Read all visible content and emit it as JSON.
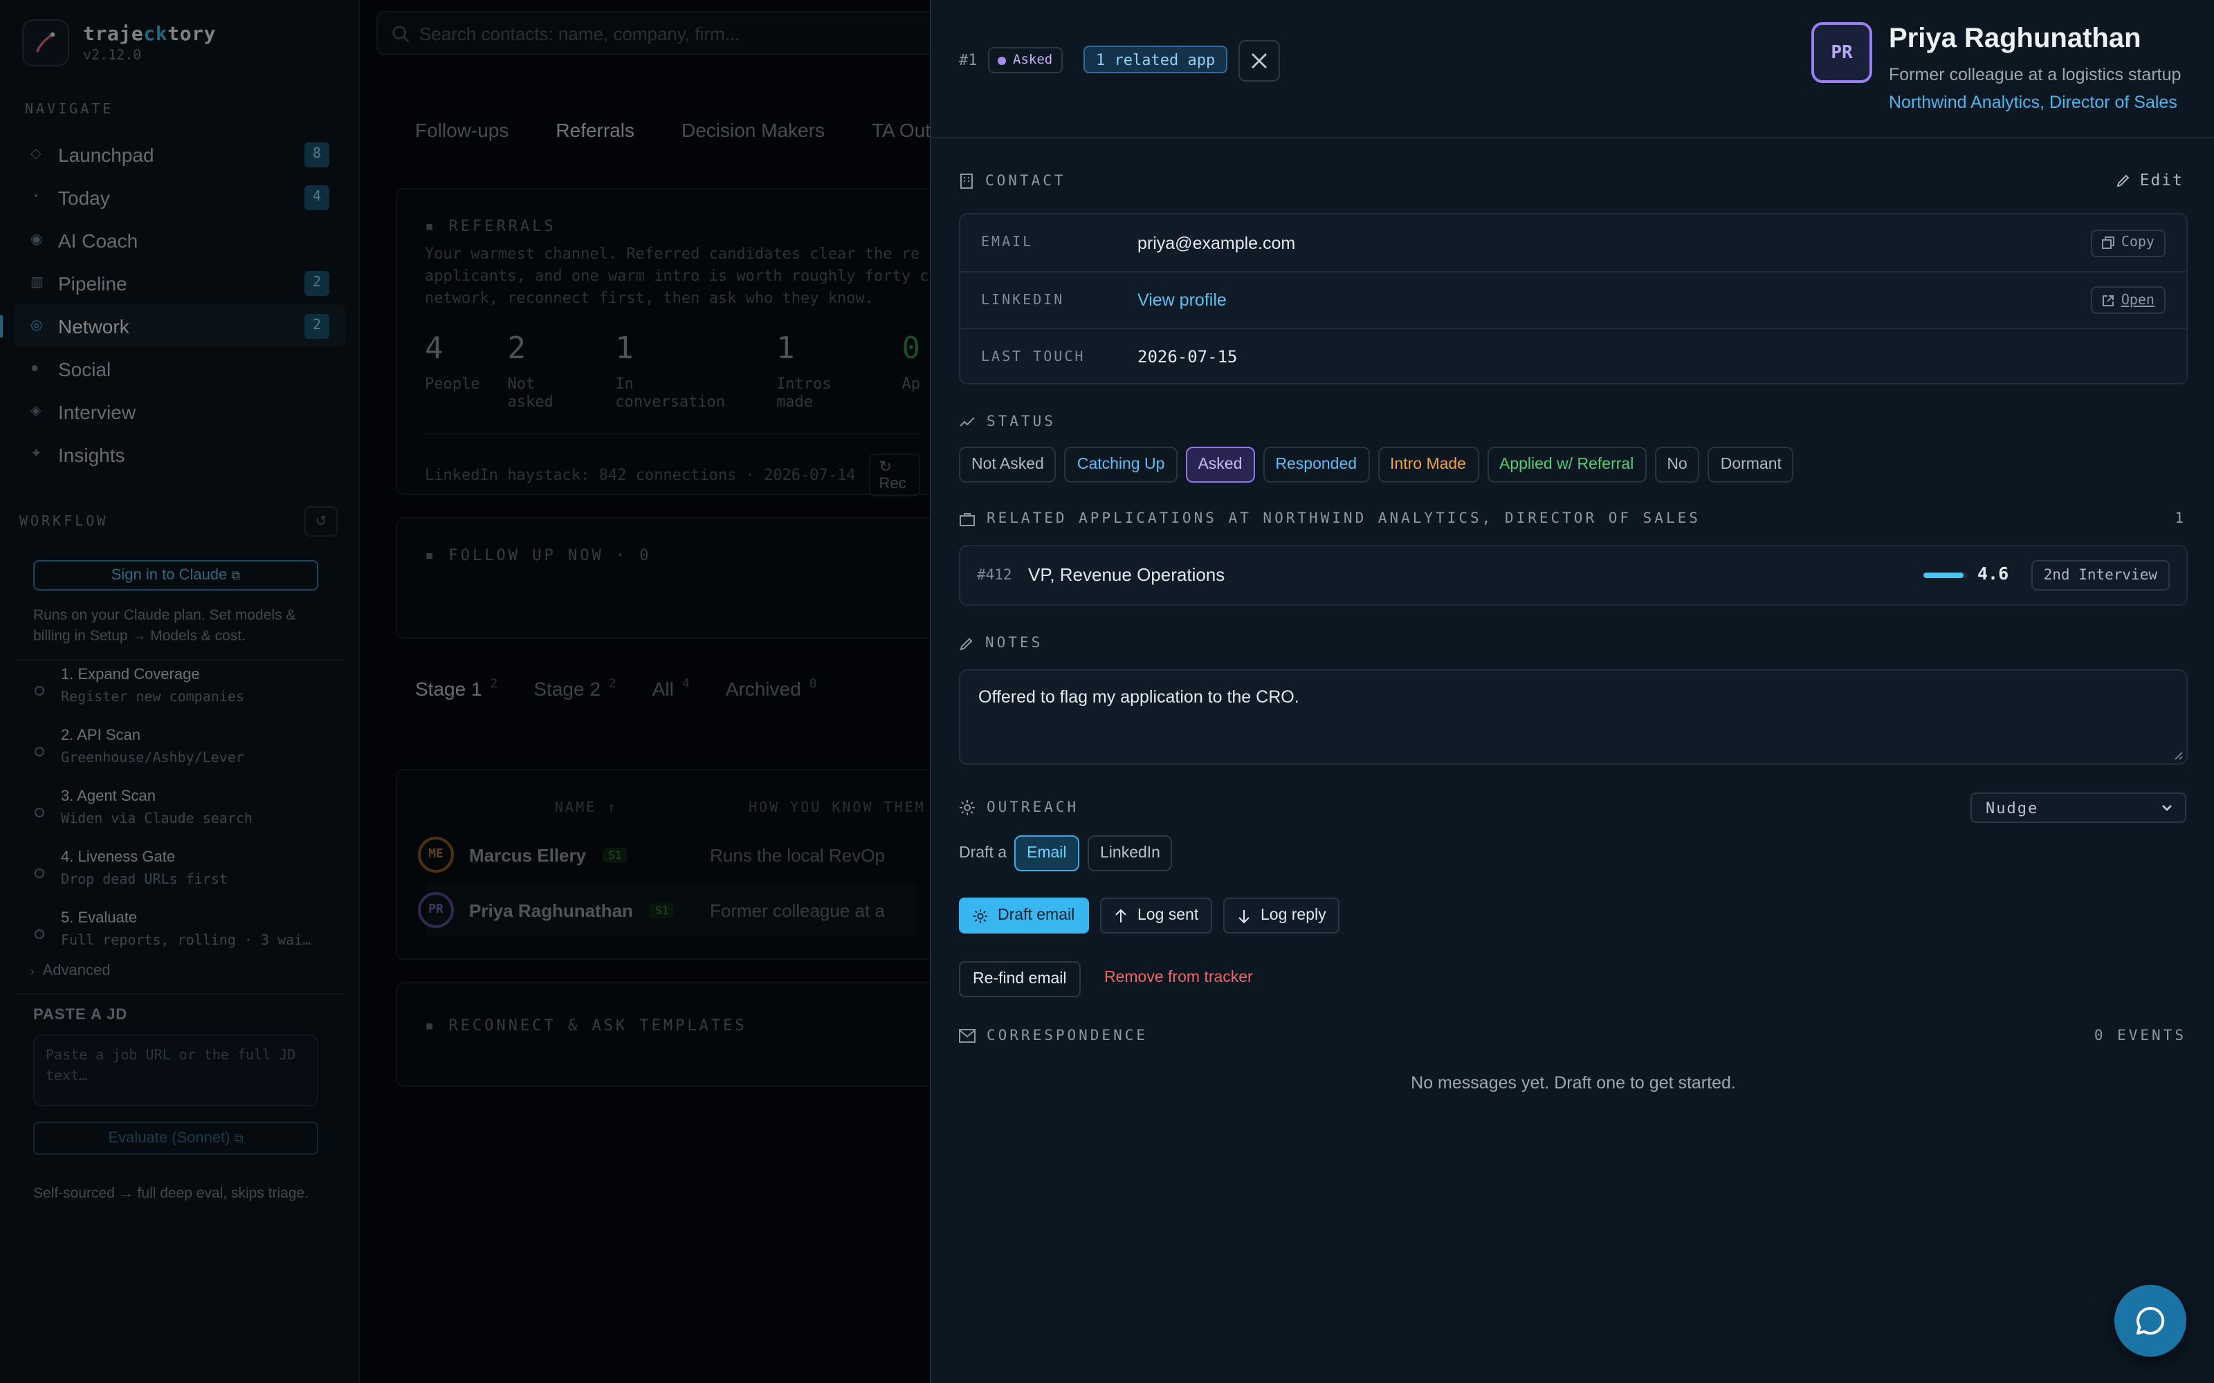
{
  "app": {
    "name_part1": "traje",
    "name_accent": "ck",
    "name_part2": "tory",
    "version": "v2.12.0"
  },
  "sidebar": {
    "navigate_title": "NAVIGATE",
    "nav": [
      {
        "label": "Launchpad",
        "count": "8",
        "icon": "diamond-icon"
      },
      {
        "label": "Today",
        "count": "4",
        "icon": "clock-icon"
      },
      {
        "label": "AI Coach",
        "count": "",
        "icon": "target-icon"
      },
      {
        "label": "Pipeline",
        "count": "2",
        "icon": "columns-icon"
      },
      {
        "label": "Network",
        "count": "2",
        "icon": "network-icon",
        "active": true
      },
      {
        "label": "Social",
        "count": "",
        "icon": "circle-icon"
      },
      {
        "label": "Interview",
        "count": "",
        "icon": "diamond-dot-icon"
      },
      {
        "label": "Insights",
        "count": "",
        "icon": "sparkle-icon"
      }
    ],
    "workflow_title": "WORKFLOW",
    "signin_label": "Sign in to Claude",
    "plan_note": "Runs on your Claude plan. Set models & billing in Setup → Models & cost.",
    "steps": [
      {
        "title": "1. Expand Coverage",
        "sub": "Register new companies"
      },
      {
        "title": "2. API Scan",
        "sub": "Greenhouse/Ashby/Lever"
      },
      {
        "title": "3. Agent Scan",
        "sub": "Widen via Claude search"
      },
      {
        "title": "4. Liveness Gate",
        "sub": "Drop dead URLs first"
      },
      {
        "title": "5. Evaluate",
        "sub": "Full reports, rolling · 3 wai…"
      }
    ],
    "advanced_label": "Advanced",
    "jd_label": "PASTE A JD",
    "jd_placeholder": "Paste a job URL or the full JD text…",
    "evaluate_label": "Evaluate (Sonnet)",
    "self_sourced_note": "Self-sourced → full deep eval, skips triage."
  },
  "main": {
    "search_placeholder": "Search contacts: name, company, firm...",
    "tabs": [
      "Follow-ups",
      "Referrals",
      "Decision Makers",
      "TA Out"
    ],
    "referrals_title": "REFERRALS",
    "referrals_desc": [
      "Your warmest channel. Referred candidates clear the re",
      "applicants, and one warm intro is worth roughly forty c",
      "network, reconnect first, then ask who they know."
    ],
    "stats": [
      {
        "n": "4",
        "l": "People"
      },
      {
        "n": "2",
        "l": "Not asked"
      },
      {
        "n": "1",
        "l": "In conversation"
      },
      {
        "n": "1",
        "l": "Intros made"
      },
      {
        "n": "0",
        "l": "Ap"
      }
    ],
    "haystack": "LinkedIn haystack: 842 connections · 2026-07-14",
    "haystack_btn": "↻ Rec",
    "followup_title": "FOLLOW UP NOW · 0",
    "stage_tabs": [
      {
        "label": "Stage 1",
        "count": "2"
      },
      {
        "label": "Stage 2",
        "count": "2"
      },
      {
        "label": "All",
        "count": "4"
      },
      {
        "label": "Archived",
        "count": "0"
      }
    ],
    "col_name": "NAME ↑",
    "col_how": "HOW YOU KNOW THEM",
    "rows": [
      {
        "initials": "ME",
        "name": "Marcus Ellery",
        "stage": "S1",
        "how": "Runs the local RevOp"
      },
      {
        "initials": "PR",
        "name": "Priya Raghunathan",
        "stage": "S1",
        "how": "Former colleague at a"
      }
    ],
    "templates_title": "RECONNECT & ASK TEMPLATES"
  },
  "drawer": {
    "id": "#1",
    "status_pill": "Asked",
    "related_pill": "1 related app",
    "initials": "PR",
    "name": "Priya Raghunathan",
    "subtitle": "Former colleague at a logistics startup",
    "company": "Northwind Analytics, Director of Sales",
    "contact_title": "CONTACT",
    "edit_label": "Edit",
    "email_key": "EMAIL",
    "email": "priya@example.com",
    "copy_label": "Copy",
    "linkedin_key": "LINKEDIN",
    "linkedin": "View profile",
    "open_label": "Open",
    "last_touch_key": "LAST TOUCH",
    "last_touch": "2026-07-15",
    "status_title": "STATUS",
    "statuses": [
      {
        "label": "Not Asked",
        "color": "#aeb9c3"
      },
      {
        "label": "Catching Up",
        "color": "#5cc0f2"
      },
      {
        "label": "Asked",
        "color": "#c9bdf8",
        "selected": true
      },
      {
        "label": "Responded",
        "color": "#5cc0f2"
      },
      {
        "label": "Intro Made",
        "color": "#f0a13c"
      },
      {
        "label": "Applied w/ Referral",
        "color": "#4fcf78"
      },
      {
        "label": "No",
        "color": "#aeb9c3"
      },
      {
        "label": "Dormant",
        "color": "#aeb9c3"
      }
    ],
    "related_title": "RELATED APPLICATIONS AT NORTHWIND ANALYTICS, DIRECTOR OF SALES",
    "related_count": "1",
    "app_id": "#412",
    "app_title": "VP, Revenue Operations",
    "app_score": "4.6",
    "app_score_fraction": 0.92,
    "app_stage": "2nd Interview",
    "notes_title": "NOTES",
    "notes": "Offered to flag my application to the CRO.",
    "outreach_title": "OUTREACH",
    "outreach_mode": "Nudge",
    "draft_a": "Draft a",
    "channel_email": "Email",
    "channel_linkedin": "LinkedIn",
    "draft_email": "Draft email",
    "log_sent": "Log sent",
    "log_reply": "Log reply",
    "refind_email": "Re-find email",
    "remove": "Remove from tracker",
    "correspondence_title": "CORRESPONDENCE",
    "events": "0 EVENTS",
    "empty_msg": "No messages yet. Draft one to get started."
  }
}
